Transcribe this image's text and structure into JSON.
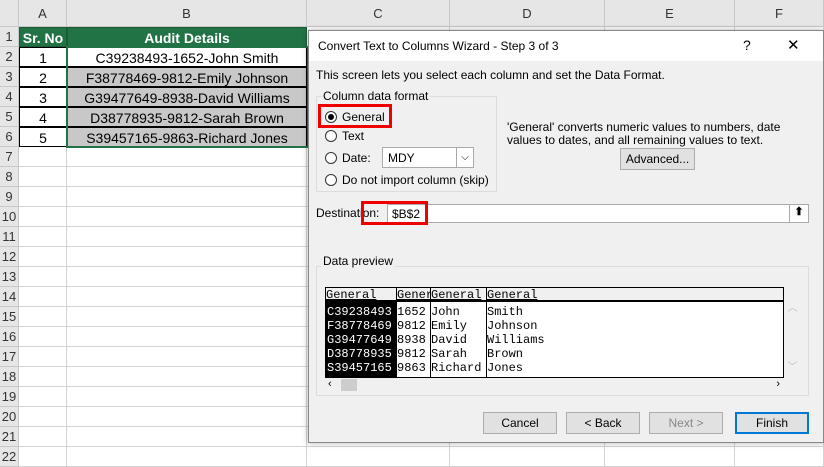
{
  "sheet": {
    "columns": [
      "A",
      "B",
      "C",
      "D",
      "E",
      "F"
    ],
    "rows": [
      "1",
      "2",
      "3",
      "4",
      "5",
      "6",
      "7",
      "8",
      "9",
      "10",
      "11",
      "12",
      "13",
      "14",
      "15",
      "16",
      "17",
      "18",
      "19",
      "20",
      "21",
      "22"
    ],
    "headers": {
      "a": "Sr. No",
      "b": "Audit Details"
    },
    "data": [
      {
        "no": "1",
        "details": "C39238493-1652-John Smith"
      },
      {
        "no": "2",
        "details": "F38778469-9812-Emily Johnson"
      },
      {
        "no": "3",
        "details": "G39477649-8938-David Williams"
      },
      {
        "no": "4",
        "details": "D38778935-9812-Sarah Brown"
      },
      {
        "no": "5",
        "details": "S39457165-9863-Richard Jones"
      }
    ]
  },
  "dialog": {
    "title": "Convert Text to Columns Wizard - Step 3 of 3",
    "help": "?",
    "close": "✕",
    "intro": "This screen lets you select each column and set the Data Format.",
    "format_group": "Column data format",
    "options": {
      "general": "General",
      "text": "Text",
      "date": "Date:",
      "skip": "Do not import column (skip)"
    },
    "date_value": "MDY",
    "info": "'General' converts numeric values to numbers, date values to dates, and all remaining values to text.",
    "advanced": "Advanced...",
    "destination_label": "Destination:",
    "destination_value": "$B$2",
    "preview_label": "Data preview",
    "preview_headers": [
      "General",
      "Gener",
      "General",
      "General"
    ],
    "preview_rows": [
      [
        "C39238493",
        "1652",
        "John",
        "Smith"
      ],
      [
        "F38778469",
        "9812",
        "Emily",
        "Johnson"
      ],
      [
        "G39477649",
        "8938",
        "David",
        "Williams"
      ],
      [
        "D38778935",
        "9812",
        "Sarah",
        "Brown"
      ],
      [
        "S39457165",
        "9863",
        "Richard",
        "Jones"
      ]
    ],
    "buttons": {
      "cancel": "Cancel",
      "back": "< Back",
      "next": "Next >",
      "finish": "Finish"
    }
  }
}
